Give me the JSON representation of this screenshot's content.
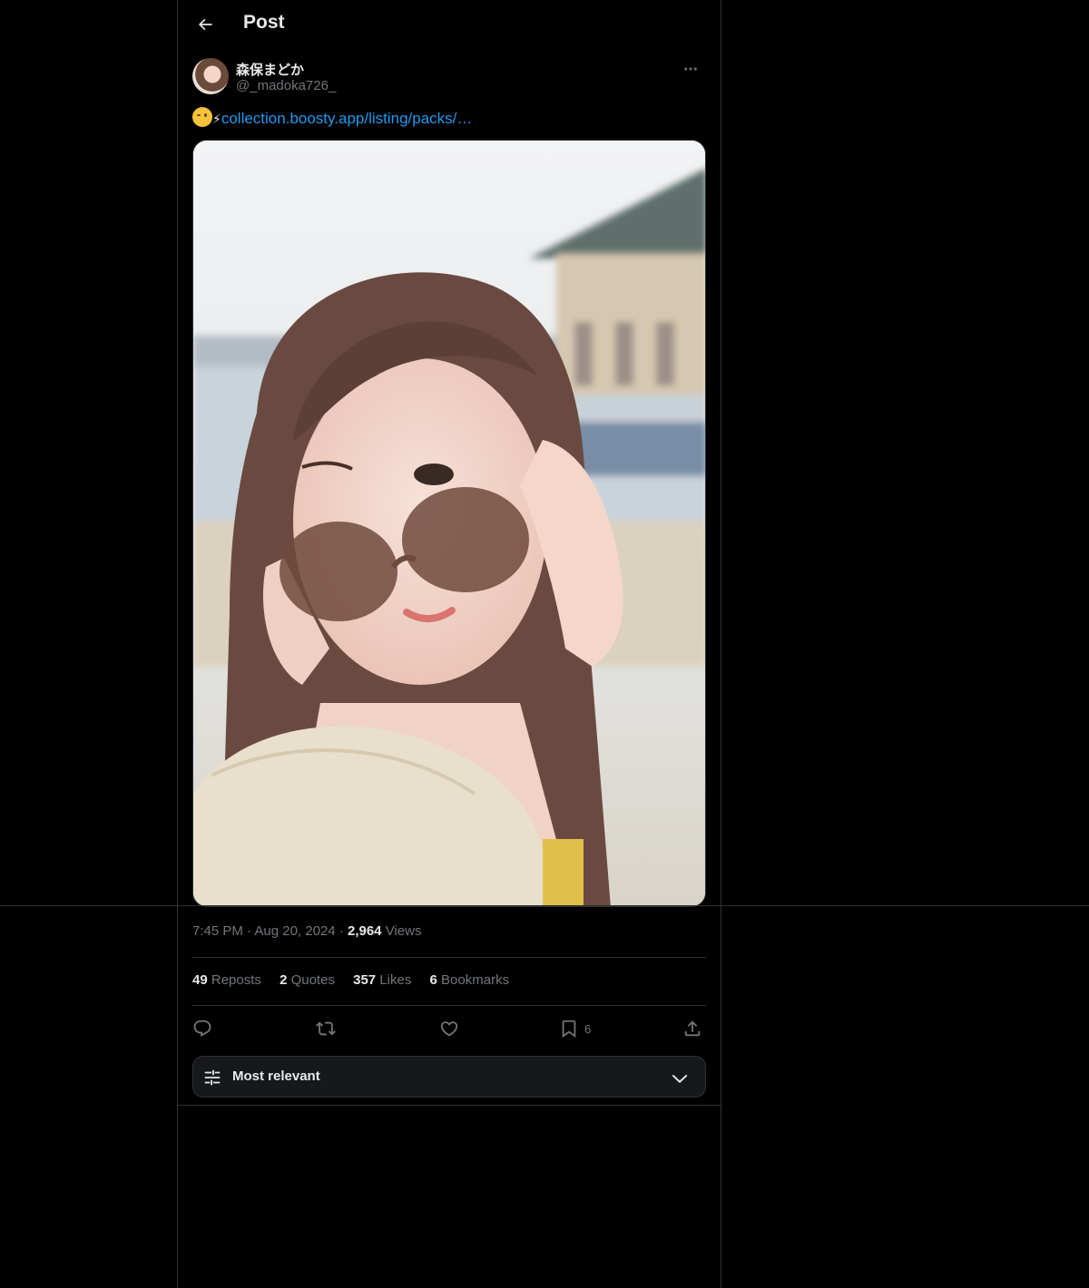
{
  "header": {
    "title": "Post"
  },
  "author": {
    "name": "森保まどか",
    "handle": "@_madoka726_"
  },
  "tweet": {
    "emoji": "😉⚡",
    "link_text": "collection.boosty.app/listing/packs/…"
  },
  "meta": {
    "time": "7:45 PM",
    "date": "Aug 20, 2024",
    "views_count": "2,964",
    "views_label": "Views"
  },
  "stats": {
    "reposts_count": "49",
    "reposts_label": "Reposts",
    "quotes_count": "2",
    "quotes_label": "Quotes",
    "likes_count": "357",
    "likes_label": "Likes",
    "bookmarks_count": "6",
    "bookmarks_label": "Bookmarks"
  },
  "actions": {
    "bookmark_count": "6"
  },
  "sort": {
    "label": "Most relevant"
  },
  "colors": {
    "background": "#000000",
    "border": "#2f3336",
    "primary_text": "#e7e9ea",
    "secondary_text": "#71767b",
    "link": "#1d9bf0"
  }
}
